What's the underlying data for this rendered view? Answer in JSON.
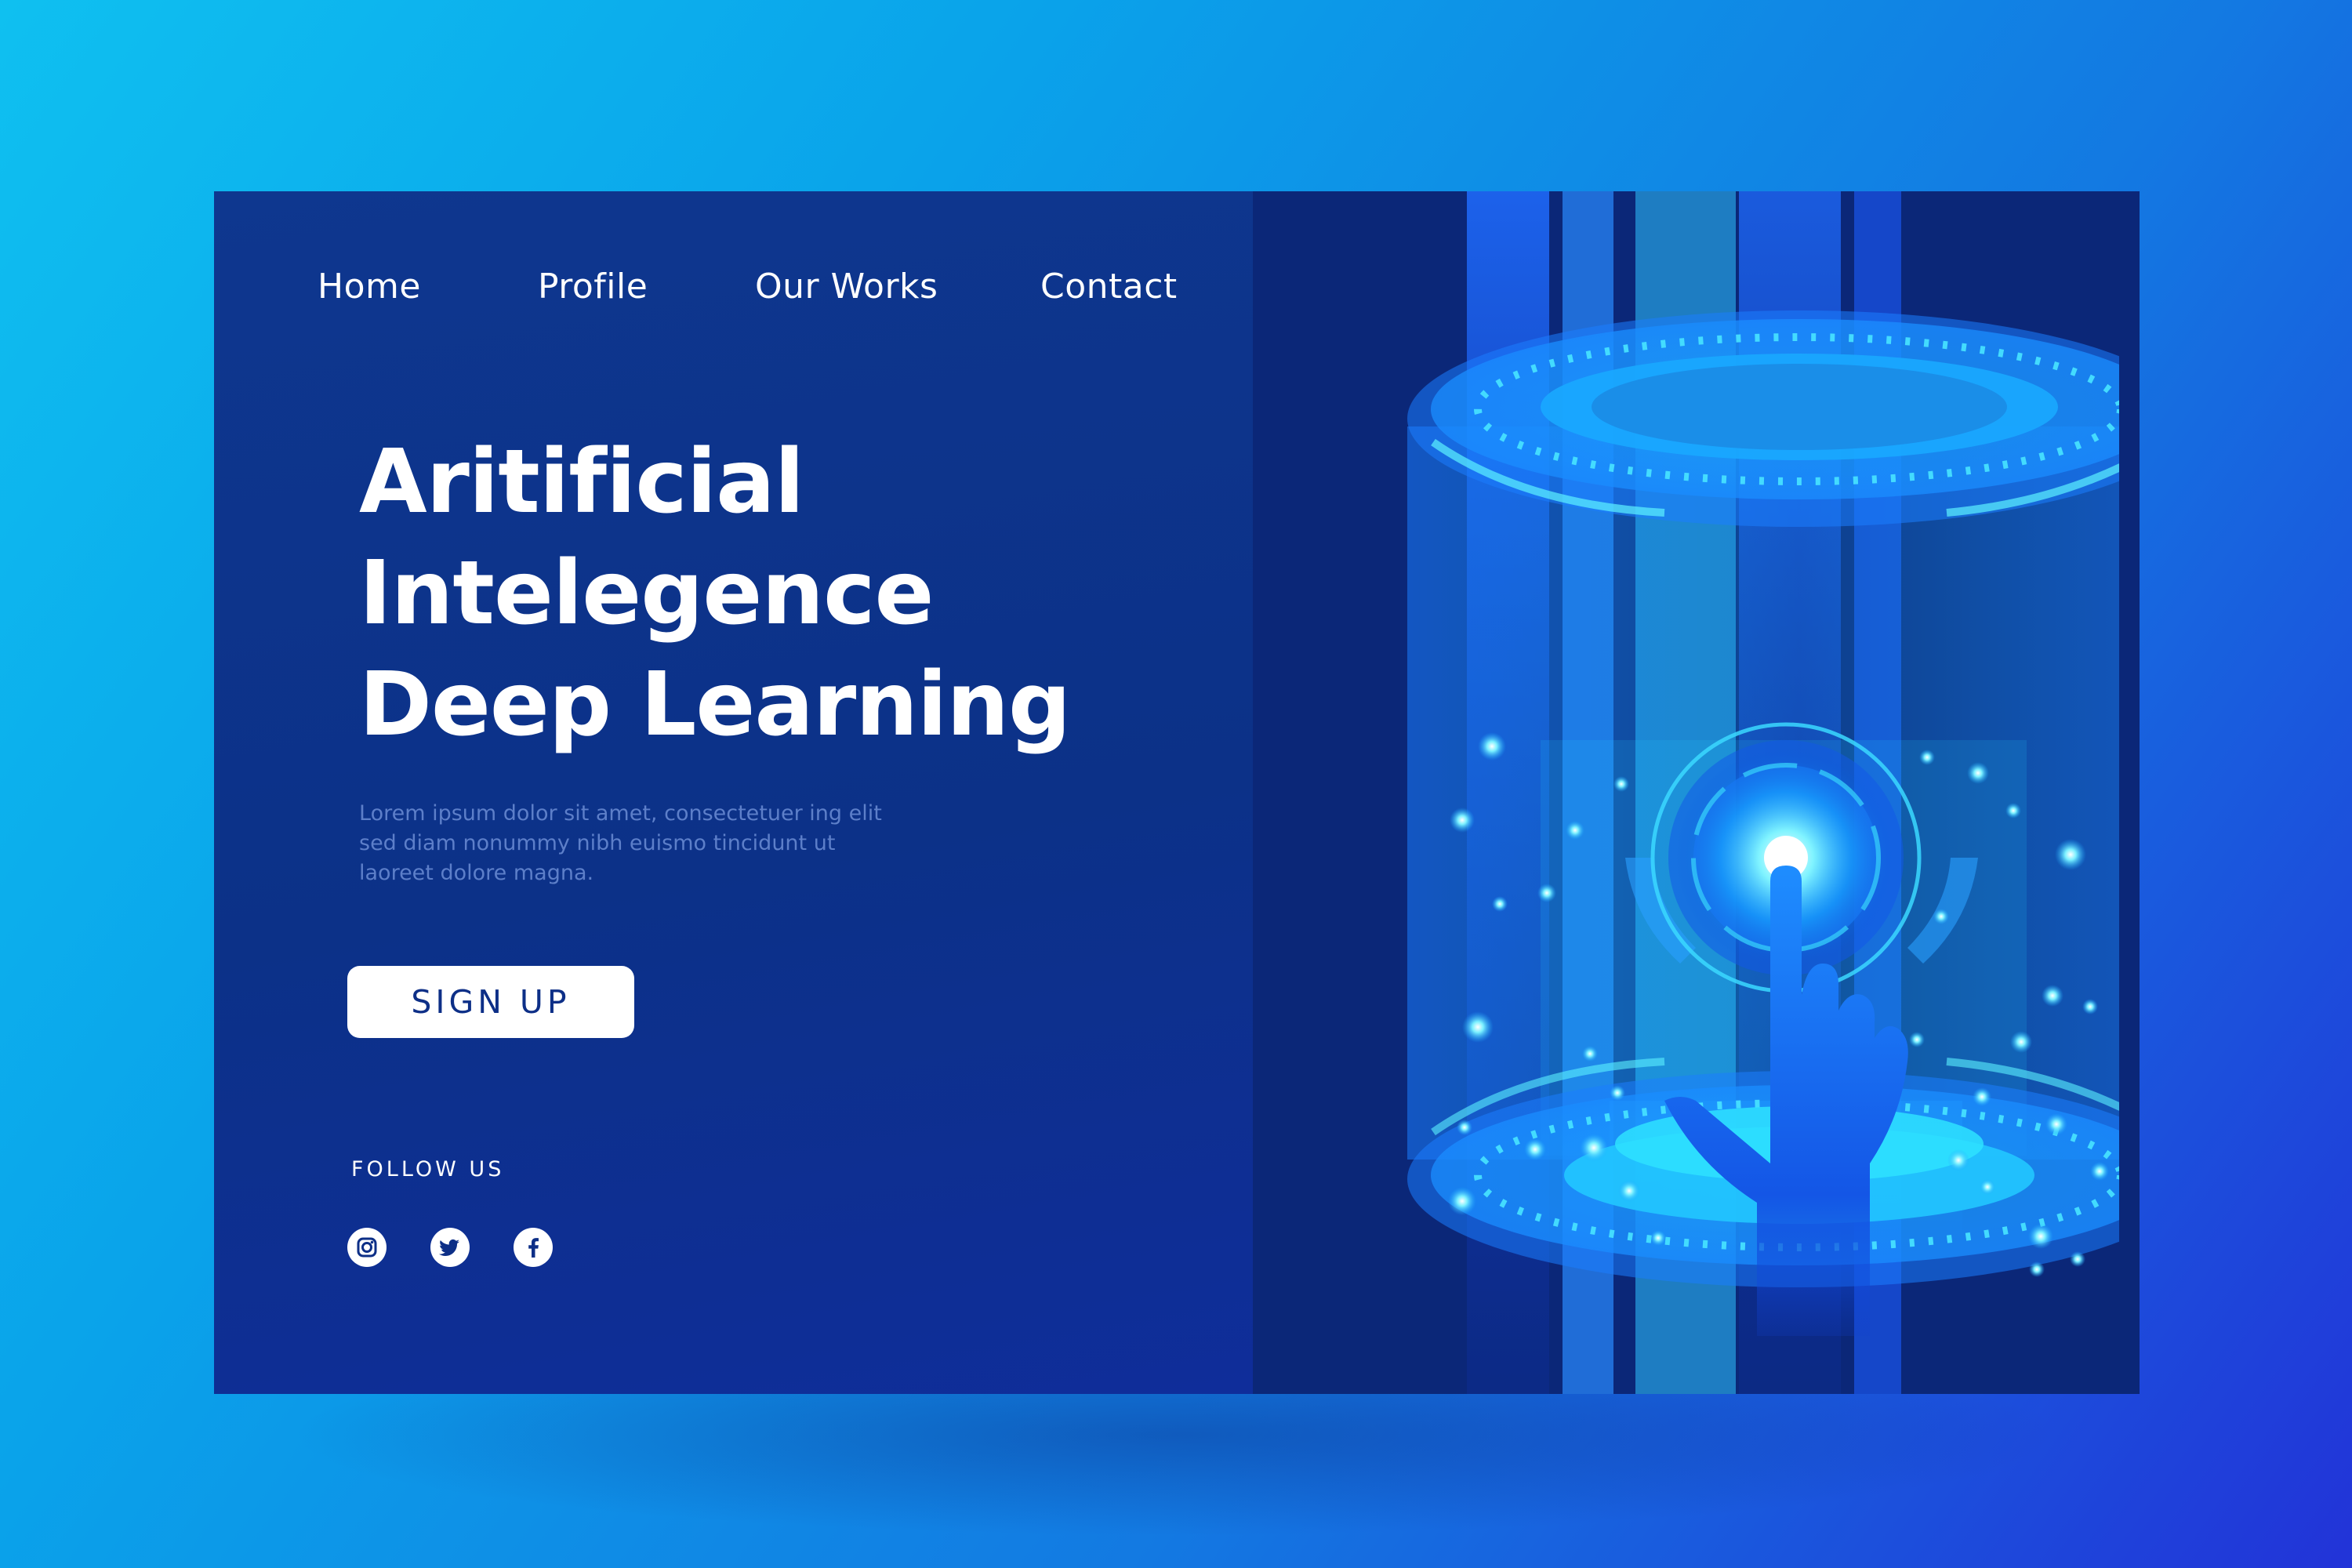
{
  "nav": {
    "items": [
      {
        "label": "Home"
      },
      {
        "label": "Profile"
      },
      {
        "label": "Our Works"
      },
      {
        "label": "Contact"
      }
    ]
  },
  "hero": {
    "title_lines": [
      "Aritificial",
      "Intelegence",
      "Deep Learning"
    ],
    "description": "Lorem ipsum dolor sit amet, consectetuer ing elit sed diam nonummy nibh euismo tincidunt ut laoreet dolore magna.",
    "cta_label": "SIGN UP"
  },
  "follow": {
    "label": "FOLLOW US",
    "icons": [
      "instagram-icon",
      "twitter-icon",
      "facebook-icon"
    ]
  },
  "colors": {
    "page_background_start": "#0fc0f0",
    "page_background_end": "#2233d8",
    "card_background": "#0c3188",
    "accent_cyan": "#38e0ff",
    "button_background": "#ffffff",
    "button_text": "#0d2f87",
    "description_text": "#5d7fc9"
  }
}
